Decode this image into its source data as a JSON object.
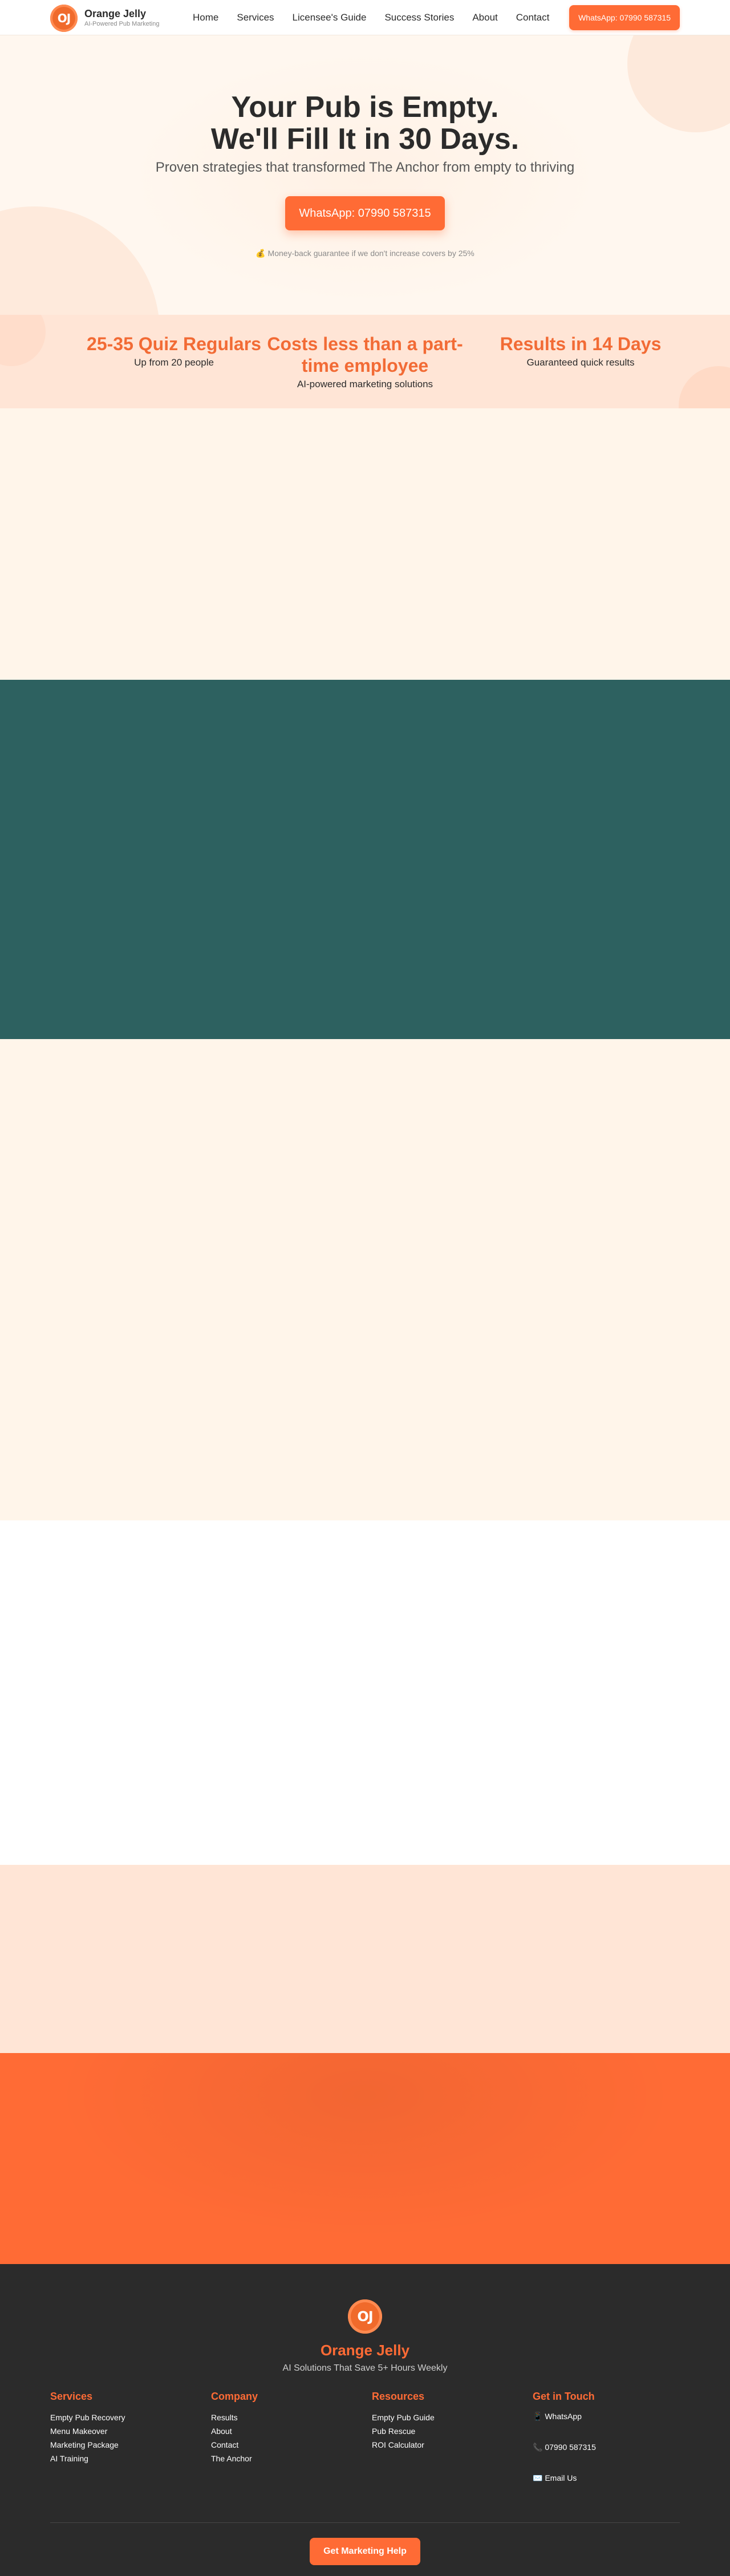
{
  "nav": {
    "logo_text": "OJ",
    "brand_name": "Orange Jelly",
    "brand_tagline": "AI-Powered Pub Marketing",
    "links": [
      "Home",
      "Services",
      "Licensee's Guide",
      "Success Stories",
      "About",
      "Contact"
    ],
    "cta": "WhatsApp: 07990 587315"
  },
  "hero": {
    "title_line1": "Your Pub is Empty.",
    "title_line2": "We'll Fill It in 30 Days.",
    "subtitle": "Proven strategies that transformed The Anchor from empty to thriving",
    "cta": "WhatsApp: 07990 587315",
    "guarantee": "💰 Money-back guarantee if we don't increase covers by 25%"
  },
  "stats": [
    {
      "title": "25-35 Quiz Regulars",
      "desc": "Up from 20 people"
    },
    {
      "title": "Costs less than a part-time employee",
      "desc": "AI-powered marketing solutions"
    },
    {
      "title": "Results in 14 Days",
      "desc": "Guaranteed quick results"
    }
  ],
  "colors": {
    "accent": "#ff6b35",
    "teal": "#2d6160",
    "cream": "#fff5ea",
    "peach": "#ffe5d6",
    "footer": "#2b2b2b"
  },
  "footer": {
    "logo_text": "OJ",
    "brand_name": "Orange Jelly",
    "tagline": "AI Solutions That Save 5+ Hours Weekly",
    "columns": [
      {
        "title": "Services",
        "items": [
          "Empty Pub Recovery",
          "Menu Makeover",
          "Marketing Package",
          "AI Training"
        ]
      },
      {
        "title": "Company",
        "items": [
          "Results",
          "About",
          "Contact",
          "The Anchor"
        ]
      },
      {
        "title": "Resources",
        "items": [
          "Empty Pub Guide",
          "Pub Rescue",
          "ROI Calculator"
        ]
      }
    ],
    "contact": {
      "title": "Get in Touch",
      "whatsapp": "📱 WhatsApp",
      "phone": "📞 07990 587315",
      "email": "✉️ Email Us"
    },
    "cta": "Get Marketing Help"
  }
}
